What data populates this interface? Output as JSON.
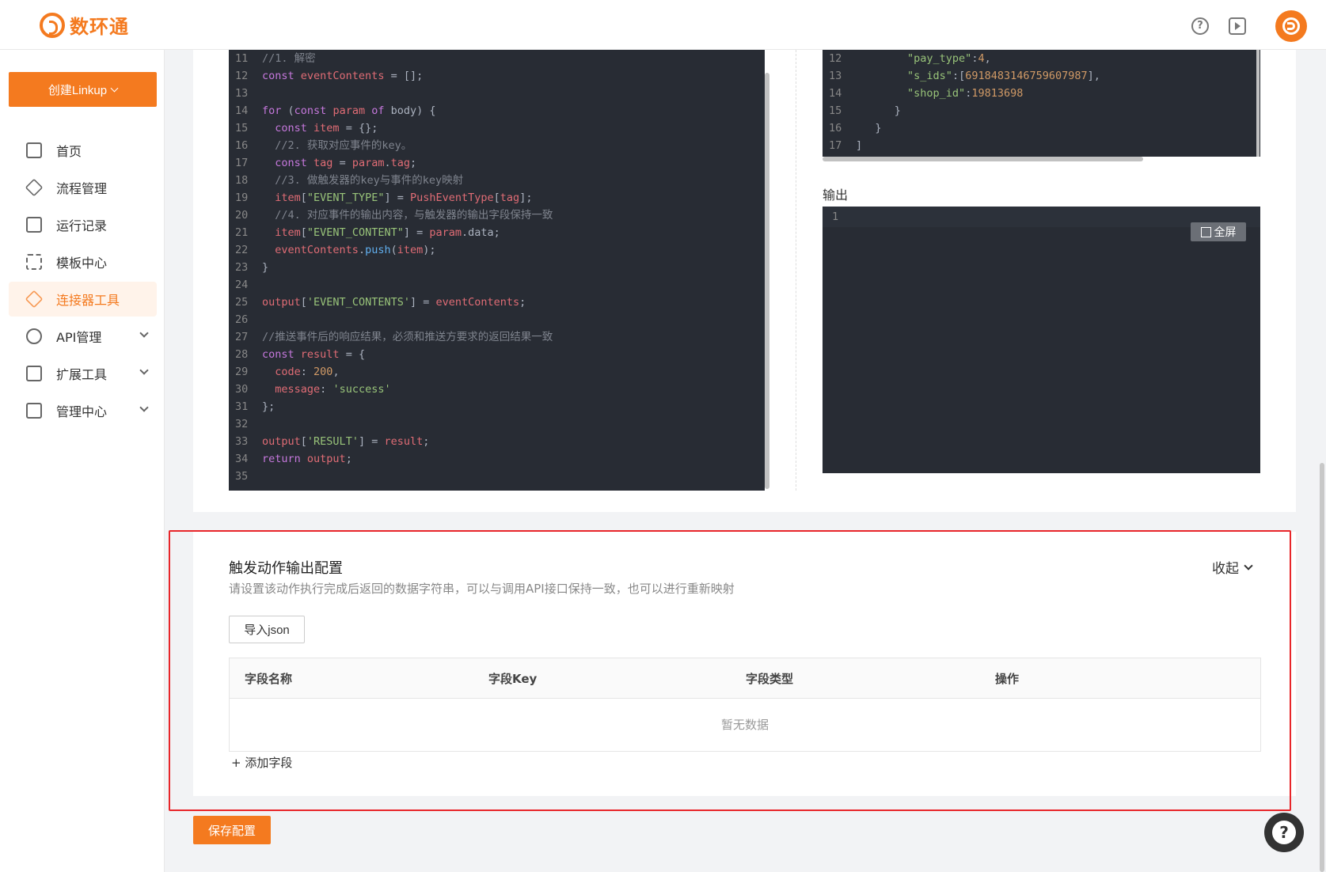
{
  "header": {
    "logo_text": "数环通"
  },
  "sidebar": {
    "create_button": "创建Linkup",
    "items": [
      {
        "label": "首页",
        "icon": "monitor-icon"
      },
      {
        "label": "流程管理",
        "icon": "layers-icon"
      },
      {
        "label": "运行记录",
        "icon": "clipboard-icon"
      },
      {
        "label": "模板中心",
        "icon": "grid-icon"
      },
      {
        "label": "连接器工具",
        "icon": "cube-icon",
        "active": true
      },
      {
        "label": "API管理",
        "icon": "share-icon",
        "expandable": true
      },
      {
        "label": "扩展工具",
        "icon": "layout-icon",
        "expandable": true
      },
      {
        "label": "管理中心",
        "icon": "building-icon",
        "expandable": true
      }
    ]
  },
  "code_left": {
    "lines": [
      {
        "n": "11",
        "t": "//1. 解密"
      },
      {
        "n": "12",
        "t": "const eventContents = [];"
      },
      {
        "n": "13",
        "t": ""
      },
      {
        "n": "14",
        "t": "for (const param of body) {"
      },
      {
        "n": "15",
        "t": "  const item = {};"
      },
      {
        "n": "16",
        "t": "  //2. 获取对应事件的key。"
      },
      {
        "n": "17",
        "t": "  const tag = param.tag;"
      },
      {
        "n": "18",
        "t": "  //3. 做触发器的key与事件的key映射"
      },
      {
        "n": "19",
        "t": "  item[\"EVENT_TYPE\"] = PushEventType[tag];"
      },
      {
        "n": "20",
        "t": "  //4. 对应事件的输出内容，与触发器的输出字段保持一致"
      },
      {
        "n": "21",
        "t": "  item[\"EVENT_CONTENT\"] = param.data;"
      },
      {
        "n": "22",
        "t": "  eventContents.push(item);"
      },
      {
        "n": "23",
        "t": "}"
      },
      {
        "n": "24",
        "t": ""
      },
      {
        "n": "25",
        "t": "output['EVENT_CONTENTS'] = eventContents;"
      },
      {
        "n": "26",
        "t": ""
      },
      {
        "n": "27",
        "t": "//推送事件后的响应结果，必须和推送方要求的返回结果一致"
      },
      {
        "n": "28",
        "t": "const result = {"
      },
      {
        "n": "29",
        "t": "  code: 200,"
      },
      {
        "n": "30",
        "t": "  message: 'success'"
      },
      {
        "n": "31",
        "t": "};"
      },
      {
        "n": "32",
        "t": ""
      },
      {
        "n": "33",
        "t": "output['RESULT'] = result;"
      },
      {
        "n": "34",
        "t": "return output;"
      },
      {
        "n": "35",
        "t": ""
      }
    ]
  },
  "code_right": {
    "lines": [
      {
        "n": "12",
        "t": "        \"pay_type\":4,"
      },
      {
        "n": "13",
        "t": "        \"s_ids\":[6918483146759607987],"
      },
      {
        "n": "14",
        "t": "        \"shop_id\":19813698"
      },
      {
        "n": "15",
        "t": "      }"
      },
      {
        "n": "16",
        "t": "   }"
      },
      {
        "n": "17",
        "t": "]"
      }
    ]
  },
  "output": {
    "label": "输出",
    "line_number": "1",
    "fullscreen_label": "全屏"
  },
  "trigger_output": {
    "title": "触发动作输出配置",
    "description": "请设置该动作执行完成后返回的数据字符串，可以与调用API接口保持一致，也可以进行重新映射",
    "collapse_label": "收起",
    "import_button": "导入json",
    "columns": [
      "字段名称",
      "字段Key",
      "字段类型",
      "操作"
    ],
    "empty_text": "暂无数据",
    "add_field": "+ 添加字段"
  },
  "save_button": "保存配置"
}
